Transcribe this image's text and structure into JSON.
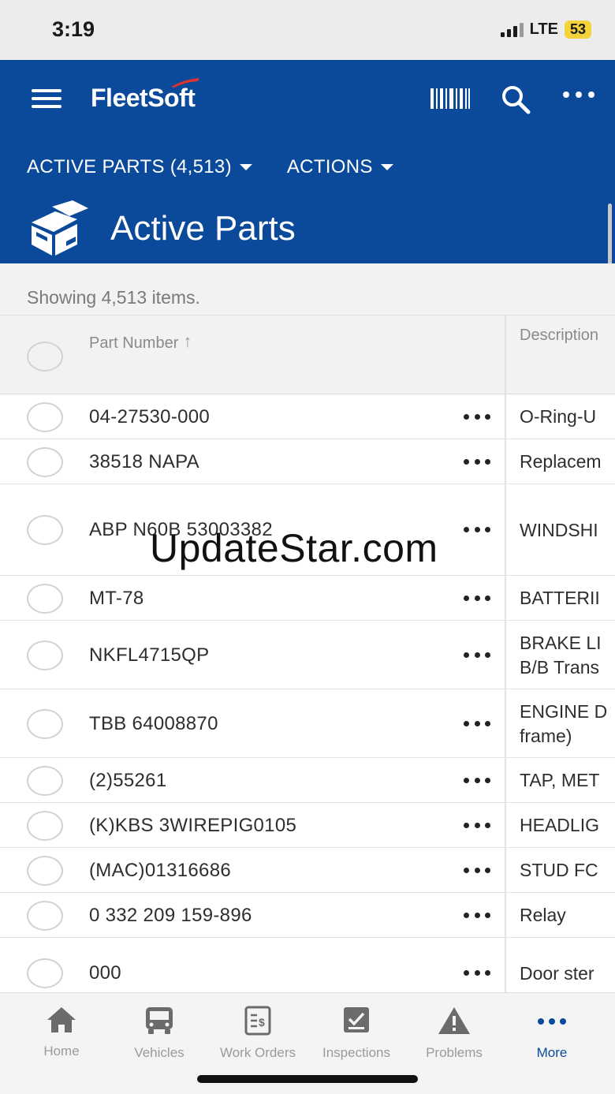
{
  "status_bar": {
    "time": "3:19",
    "network": "LTE",
    "battery": "53"
  },
  "header": {
    "logo": "FleetSoft",
    "active_parts_dropdown": "ACTIVE PARTS (4,513)",
    "actions_dropdown": "ACTIONS",
    "page_title": "Active Parts",
    "icons": [
      "menu-icon",
      "barcode-icon",
      "search-icon",
      "more-icon",
      "parts-boxes-icon"
    ],
    "accent_color": "#0b4a9a"
  },
  "list": {
    "showing_text": "Showing 4,513 items.",
    "columns": {
      "part_number": "Part Number",
      "description": "Description"
    },
    "sort": "ascending",
    "rows": [
      {
        "part": "04-27530-000",
        "desc_lines": [
          "O-Ring-U"
        ]
      },
      {
        "part": "38518 NAPA",
        "desc_lines": [
          "Replacem"
        ]
      },
      {
        "part": "ABP N60B 53003382",
        "desc_lines": [
          "WINDSHI"
        ]
      },
      {
        "part": "MT-78",
        "desc_lines": [
          "BATTERII"
        ]
      },
      {
        "part": "NKFL4715QP",
        "desc_lines": [
          "BRAKE LI",
          "B/B Trans"
        ]
      },
      {
        "part": "TBB 64008870",
        "desc_lines": [
          "ENGINE D",
          "frame)"
        ]
      },
      {
        "part": "(2)55261",
        "desc_lines": [
          "TAP, MET"
        ]
      },
      {
        "part": "(K)KBS 3WIREPIG0105",
        "desc_lines": [
          "HEADLIG"
        ]
      },
      {
        "part": "(MAC)01316686",
        "desc_lines": [
          "STUD FC"
        ]
      },
      {
        "part": "0 332 209 159-896",
        "desc_lines": [
          "Relay"
        ]
      },
      {
        "part": "000",
        "desc_lines": [
          "Door ster"
        ]
      }
    ]
  },
  "watermark": "UpdateStar.com",
  "bottom_nav": {
    "items": [
      {
        "label": "Home",
        "icon": "home-icon",
        "active": false
      },
      {
        "label": "Vehicles",
        "icon": "bus-icon",
        "active": false
      },
      {
        "label": "Work Orders",
        "icon": "work-order-icon",
        "active": false
      },
      {
        "label": "Inspections",
        "icon": "inspection-icon",
        "active": false
      },
      {
        "label": "Problems",
        "icon": "warning-icon",
        "active": false
      },
      {
        "label": "More",
        "icon": "more-dots-icon",
        "active": true
      }
    ]
  }
}
